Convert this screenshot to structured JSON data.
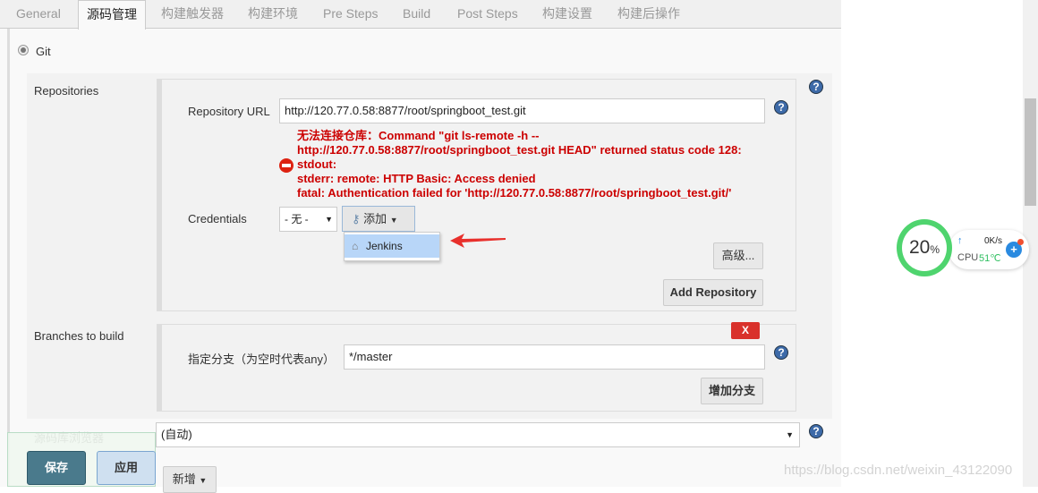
{
  "tabs": [
    "General",
    "源码管理",
    "构建触发器",
    "构建环境",
    "Pre Steps",
    "Build",
    "Post Steps",
    "构建设置",
    "构建后操作"
  ],
  "scm": {
    "git_label": "Git"
  },
  "repositories": {
    "label": "Repositories",
    "url_label": "Repository URL",
    "url_value": "http://120.77.0.58:8877/root/springboot_test.git",
    "error_lines": [
      "无法连接仓库：Command \"git ls-remote -h --",
      "http://120.77.0.58:8877/root/springboot_test.git HEAD\" returned status code 128:",
      "stdout:",
      "stderr: remote: HTTP Basic: Access denied",
      "fatal: Authentication failed for 'http://120.77.0.58:8877/root/springboot_test.git/'"
    ],
    "credentials_label": "Credentials",
    "credentials_value": "- 无 -",
    "add_label": "添加",
    "dropdown_item": "Jenkins",
    "advanced_label": "高级...",
    "add_repo_label": "Add Repository"
  },
  "branches": {
    "label": "Branches to build",
    "delete_label": "X",
    "branch_label": "指定分支（为空时代表any）",
    "branch_value": "*/master",
    "add_branch_label": "增加分支"
  },
  "browser": {
    "label": "源码库浏览器",
    "value": "(自动)",
    "add_label": "新增"
  },
  "footer": {
    "save": "保存",
    "apply": "应用"
  },
  "widget": {
    "percent": "20",
    "percent_unit": "%",
    "net": "0K/s",
    "cpu_label": "CPU",
    "cpu_temp": "51℃"
  },
  "watermark": "https://blog.csdn.net/weixin_43122090",
  "colors": {
    "error": "#cc0000",
    "save": "#4a7a8c",
    "accent": "#3d6aa8"
  }
}
